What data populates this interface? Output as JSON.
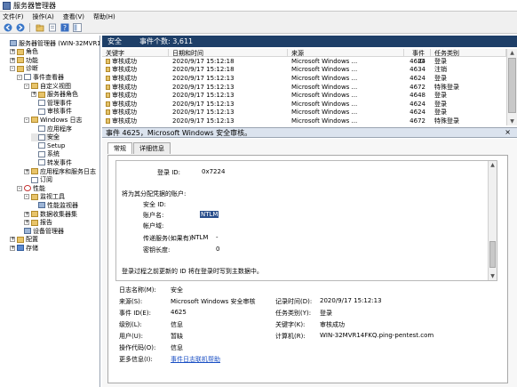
{
  "window": {
    "title": "服务器管理器"
  },
  "menu": [
    "文件(F)",
    "操作(A)",
    "查看(V)",
    "帮助(H)"
  ],
  "tree": [
    {
      "label": "服务器管理器 (WIN-32MVR14FKQ)",
      "indent": 0,
      "expander": "",
      "icon": "comp"
    },
    {
      "label": "角色",
      "indent": 1,
      "expander": "+",
      "icon": "folder"
    },
    {
      "label": "功能",
      "indent": 1,
      "expander": "+",
      "icon": "folder"
    },
    {
      "label": "诊断",
      "indent": 1,
      "expander": "-",
      "icon": "folder"
    },
    {
      "label": "事件查看器",
      "indent": 2,
      "expander": "-",
      "icon": "log"
    },
    {
      "label": "自定义视图",
      "indent": 3,
      "expander": "-",
      "icon": "folder"
    },
    {
      "label": "服务器角色",
      "indent": 4,
      "expander": "+",
      "icon": "folder"
    },
    {
      "label": "管理事件",
      "indent": 4,
      "expander": "",
      "icon": "log"
    },
    {
      "label": "审核事件",
      "indent": 4,
      "expander": "",
      "icon": "log"
    },
    {
      "label": "Windows 日志",
      "indent": 3,
      "expander": "-",
      "icon": "folder"
    },
    {
      "label": "应用程序",
      "indent": 4,
      "expander": "",
      "icon": "log"
    },
    {
      "label": "安全",
      "indent": 4,
      "expander": "",
      "icon": "log",
      "selected": true
    },
    {
      "label": "Setup",
      "indent": 4,
      "expander": "",
      "icon": "log"
    },
    {
      "label": "系统",
      "indent": 4,
      "expander": "",
      "icon": "log"
    },
    {
      "label": "转发事件",
      "indent": 4,
      "expander": "",
      "icon": "log"
    },
    {
      "label": "应用程序和服务日志",
      "indent": 3,
      "expander": "+",
      "icon": "folder"
    },
    {
      "label": "订阅",
      "indent": 3,
      "expander": "",
      "icon": "log"
    },
    {
      "label": "性能",
      "indent": 2,
      "expander": "-",
      "icon": "red"
    },
    {
      "label": "监视工具",
      "indent": 3,
      "expander": "-",
      "icon": "folder"
    },
    {
      "label": "性能监视器",
      "indent": 4,
      "expander": "",
      "icon": "comp"
    },
    {
      "label": "数据收集器集",
      "indent": 3,
      "expander": "+",
      "icon": "folder"
    },
    {
      "label": "报告",
      "indent": 3,
      "expander": "+",
      "icon": "folder"
    },
    {
      "label": "设备管理器",
      "indent": 2,
      "expander": "",
      "icon": "comp"
    },
    {
      "label": "配置",
      "indent": 1,
      "expander": "+",
      "icon": "folder"
    },
    {
      "label": "存储",
      "indent": 1,
      "expander": "+",
      "icon": "blue"
    }
  ],
  "list_header": {
    "tab1": "安全",
    "tab2": "事件个数: 3,611"
  },
  "event_columns": [
    "关键字",
    "日期和时间",
    "来源",
    "事件 ID",
    "任务类别"
  ],
  "events": [
    {
      "keyword": "审核成功",
      "datetime": "2020/9/17 15:12:18",
      "source": "Microsoft Windows ...",
      "id": "4624",
      "task": "登录"
    },
    {
      "keyword": "审核成功",
      "datetime": "2020/9/17 15:12:18",
      "source": "Microsoft Windows ...",
      "id": "4634",
      "task": "注销"
    },
    {
      "keyword": "审核成功",
      "datetime": "2020/9/17 15:12:13",
      "source": "Microsoft Windows ...",
      "id": "4624",
      "task": "登录"
    },
    {
      "keyword": "审核成功",
      "datetime": "2020/9/17 15:12:13",
      "source": "Microsoft Windows ...",
      "id": "4672",
      "task": "特殊登录"
    },
    {
      "keyword": "审核成功",
      "datetime": "2020/9/17 15:12:13",
      "source": "Microsoft Windows ...",
      "id": "4648",
      "task": "登录"
    },
    {
      "keyword": "审核成功",
      "datetime": "2020/9/17 15:12:13",
      "source": "Microsoft Windows ...",
      "id": "4624",
      "task": "登录"
    },
    {
      "keyword": "审核成功",
      "datetime": "2020/9/17 15:12:13",
      "source": "Microsoft Windows ...",
      "id": "4624",
      "task": "登录"
    },
    {
      "keyword": "审核成功",
      "datetime": "2020/9/17 15:12:13",
      "source": "Microsoft Windows ...",
      "id": "4672",
      "task": "特殊登录"
    },
    {
      "keyword": "审核成功",
      "datetime": "2020/9/17 15:12:13",
      "source": "Microsoft Windows ...",
      "id": "4624",
      "task": "登录"
    }
  ],
  "detail": {
    "title": "事件 4625，Microsoft Windows 安全审核。",
    "close": "×",
    "tab_general": "常规",
    "tab_details": "详细信息",
    "lines": {
      "l1_label": "登录 ID:",
      "l1_value": "0x7224",
      "l2": "将为其分配凭据的账户:",
      "l3": "安全 ID:",
      "l4_label": "账户名:",
      "l4_value": "NTLM",
      "l5": "帐户域:",
      "l6_label": "传递服务(如果有):",
      "l6_value": "NTLM",
      "l6_dash": "-",
      "l7_label": "密钥长度:",
      "l7_value": "0",
      "l8": "登录过程之前更新的 ID 将在登录时写到主数据中。"
    },
    "props": {
      "log_name_label": "日志名称(M):",
      "log_name": "安全",
      "source_label": "来源(S):",
      "source": "Microsoft Windows 安全审核",
      "logged_label": "记录时间(D):",
      "logged": "2020/9/17 15:12:13",
      "event_id_label": "事件 ID(E):",
      "event_id": "4625",
      "task_label": "任务类别(Y):",
      "task": "登录",
      "level_label": "级别(L):",
      "level": "信息",
      "keywords_label": "关键字(K):",
      "keywords": "审核成功",
      "user_label": "用户(U):",
      "user": "暂缺",
      "computer_label": "计算机(R):",
      "computer": "WIN-32MVR14FKQ.ping-pentest.com",
      "opcode_label": "操作代码(O):",
      "opcode": "信息",
      "more_label": "更多信息(I):",
      "more_link": "事件日志联机帮助"
    }
  }
}
